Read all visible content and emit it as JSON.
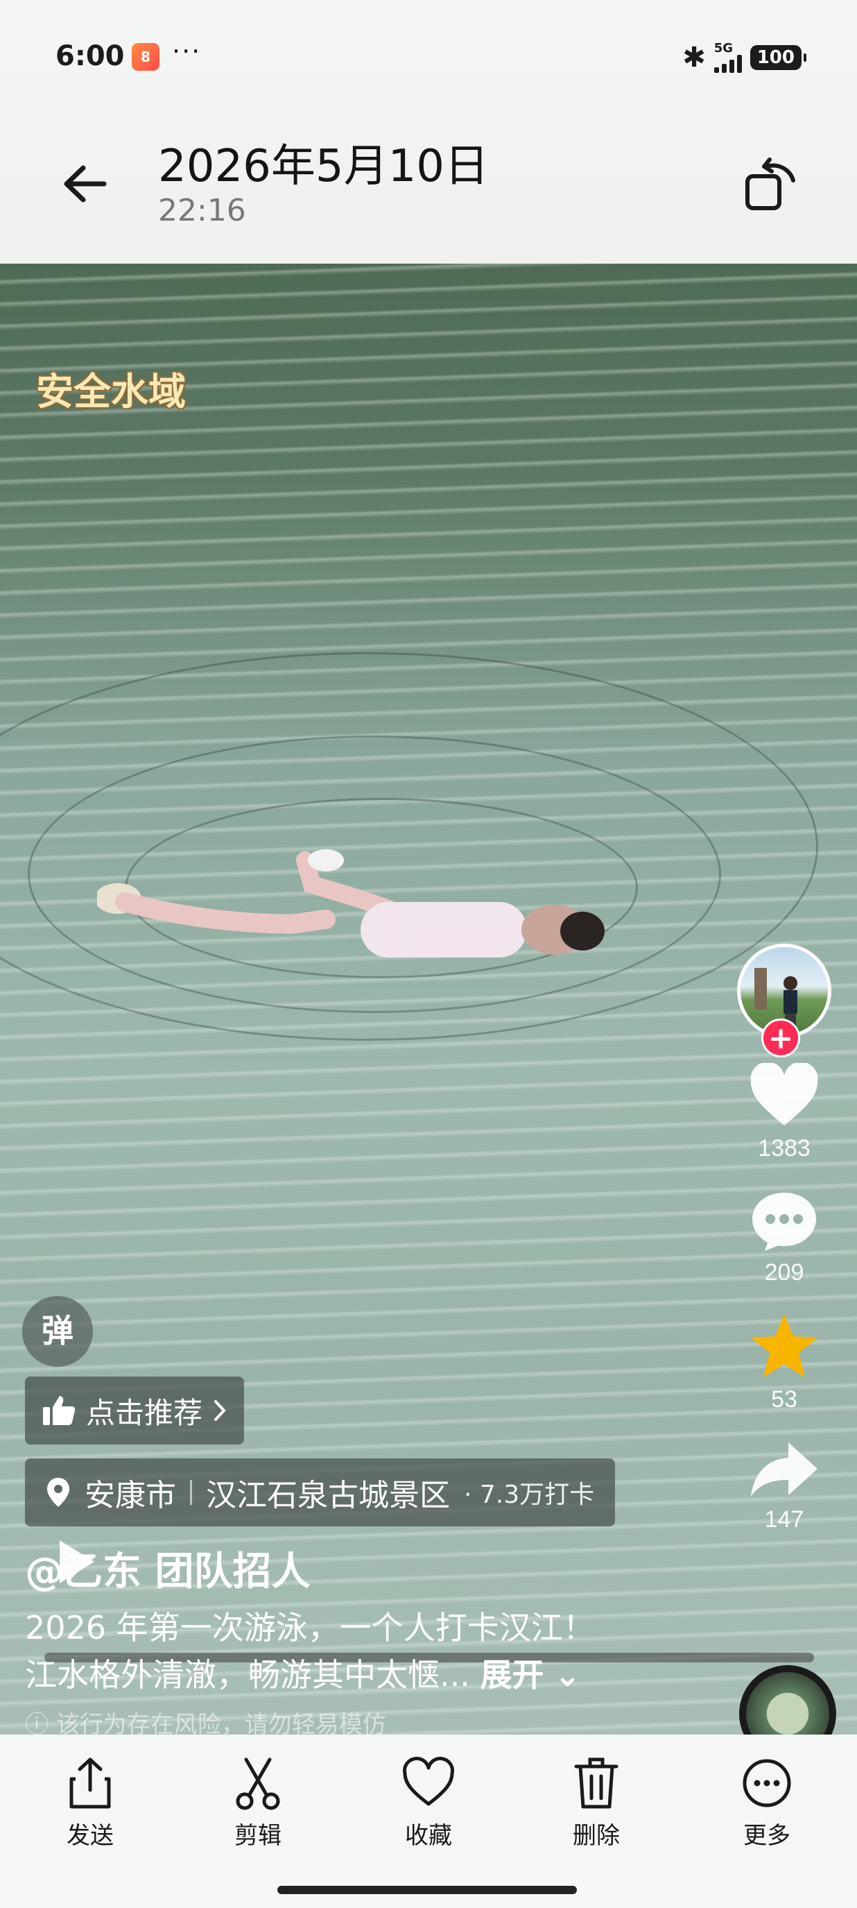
{
  "status_bar": {
    "time": "6:00",
    "app_badge": "8",
    "more_indicator": "···",
    "network": "5G",
    "battery": "100"
  },
  "header": {
    "date": "2026年5月10日",
    "time": "22:16"
  },
  "video": {
    "overlay_text": "安全水域",
    "danmu_label": "弹",
    "recommend_label": "点击推荐",
    "location": {
      "city": "安康市",
      "place": "汉江石泉古城景区",
      "checkins": "· 7.3万打卡"
    },
    "author": "@乙东 团队招人",
    "caption_line1": "2026 年第一次游泳，一个人打卡汉江！",
    "caption_line2": "江水格外清澈，畅游其中太惬...",
    "expand_label": "展开",
    "warning": "该行为存在风险，请勿轻易模仿",
    "progress": 0.0
  },
  "rail": {
    "likes": "1383",
    "comments": "209",
    "favorites": "53",
    "shares": "147"
  },
  "toolbar": {
    "send": "发送",
    "edit": "剪辑",
    "favorite": "收藏",
    "delete": "删除",
    "more": "更多"
  },
  "colors": {
    "follow_accent": "#fe2c55",
    "favorite_star": "#f7b500"
  }
}
